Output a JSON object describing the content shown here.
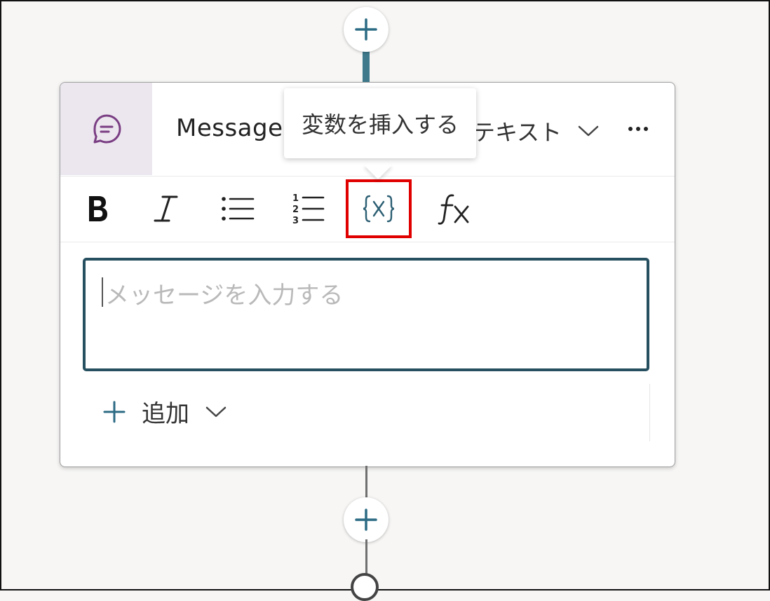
{
  "canvas": {
    "accent_color": "#3e7a8c",
    "highlight_color": "#e00000"
  },
  "node": {
    "title": "Message",
    "kind_label": "テキスト",
    "header_icon": "chat-bubble-icon",
    "more_icon": "more-horizontal-icon"
  },
  "toolbar": {
    "buttons": [
      {
        "name": "bold",
        "icon": "bold-icon"
      },
      {
        "name": "italic",
        "icon": "italic-icon"
      },
      {
        "name": "bulleted-list",
        "icon": "bulleted-list-icon"
      },
      {
        "name": "numbered-list",
        "icon": "numbered-list-icon"
      },
      {
        "name": "insert-variable",
        "icon": "variable-icon",
        "highlighted": true
      },
      {
        "name": "formula",
        "icon": "fx-icon"
      }
    ]
  },
  "tooltip": {
    "text": "変数を挿入する"
  },
  "message_input": {
    "placeholder": "メッセージを入力する",
    "value": ""
  },
  "add_menu": {
    "label": "追加"
  }
}
